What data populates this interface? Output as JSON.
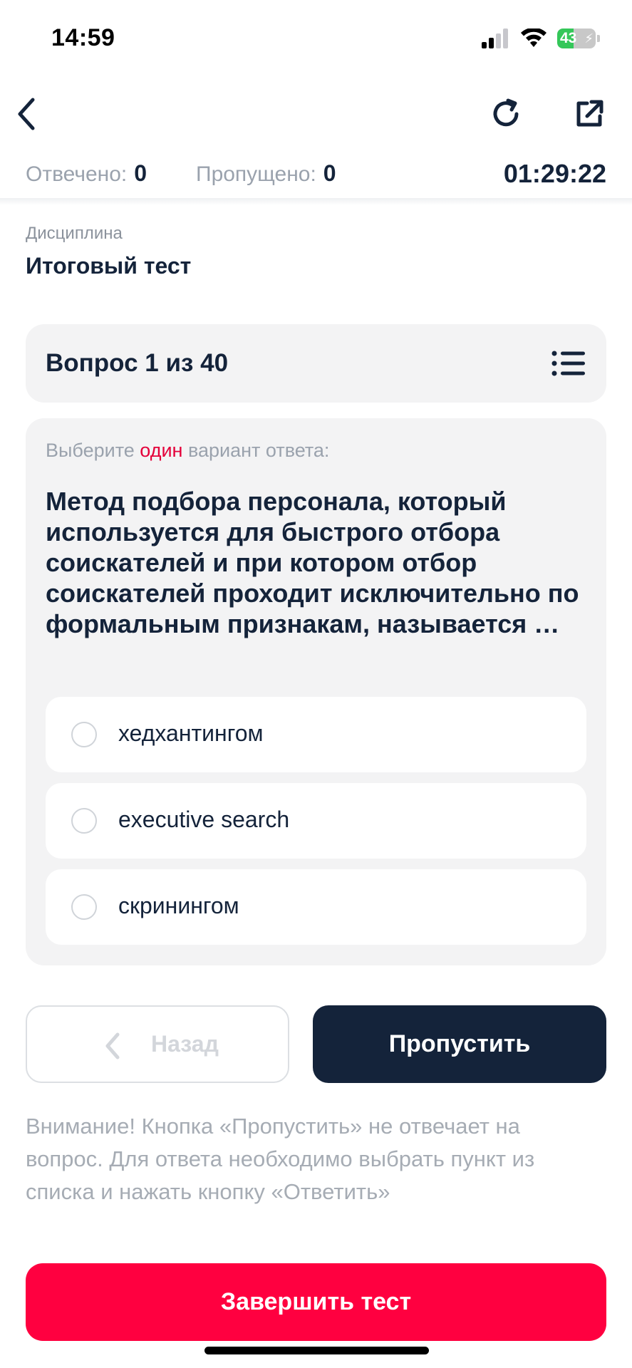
{
  "status_bar": {
    "time": "14:59",
    "battery_percent": "43",
    "battery_level": 0.43,
    "signal_icon": "cellular-signal-icon",
    "wifi_icon": "wifi-icon"
  },
  "nav": {
    "back_icon": "chevron-left-icon",
    "refresh_icon": "refresh-icon",
    "share_icon": "external-link-icon"
  },
  "counters": {
    "answered_label": "Отвечено:",
    "answered_value": "0",
    "skipped_label": "Пропущено:",
    "skipped_value": "0",
    "timer": "01:29:22"
  },
  "discipline": {
    "label": "Дисциплина",
    "value": "Итоговый тест"
  },
  "question_header": {
    "number_text": "Вопрос 1 из 40",
    "list_icon": "list-icon"
  },
  "question": {
    "instruction_prefix": "Выберите ",
    "instruction_highlight": "один",
    "instruction_suffix": " вариант ответа:",
    "text": "Метод подбора персонала, который используется для быстрого отбора соискателей и при котором отбор соискателей проходит исключительно по формальным признакам, называется …",
    "options": [
      {
        "label": "хедхантингом",
        "selected": false
      },
      {
        "label": "executive search",
        "selected": false
      },
      {
        "label": "скринингом",
        "selected": false
      }
    ]
  },
  "actions": {
    "back_label": "Назад",
    "skip_label": "Пропустить",
    "notice": "Внимание! Кнопка «Пропустить» не отвечает на вопрос. Для ответа необходимо выбрать пункт из списка и нажать кнопку «Ответить»",
    "finish_label": "Завершить тест"
  },
  "colors": {
    "primary_dark": "#14233a",
    "accent_red": "#ff0040",
    "highlight_red": "#e4003a",
    "card_bg": "#f3f3f4",
    "muted_text": "#9aa2ad"
  }
}
